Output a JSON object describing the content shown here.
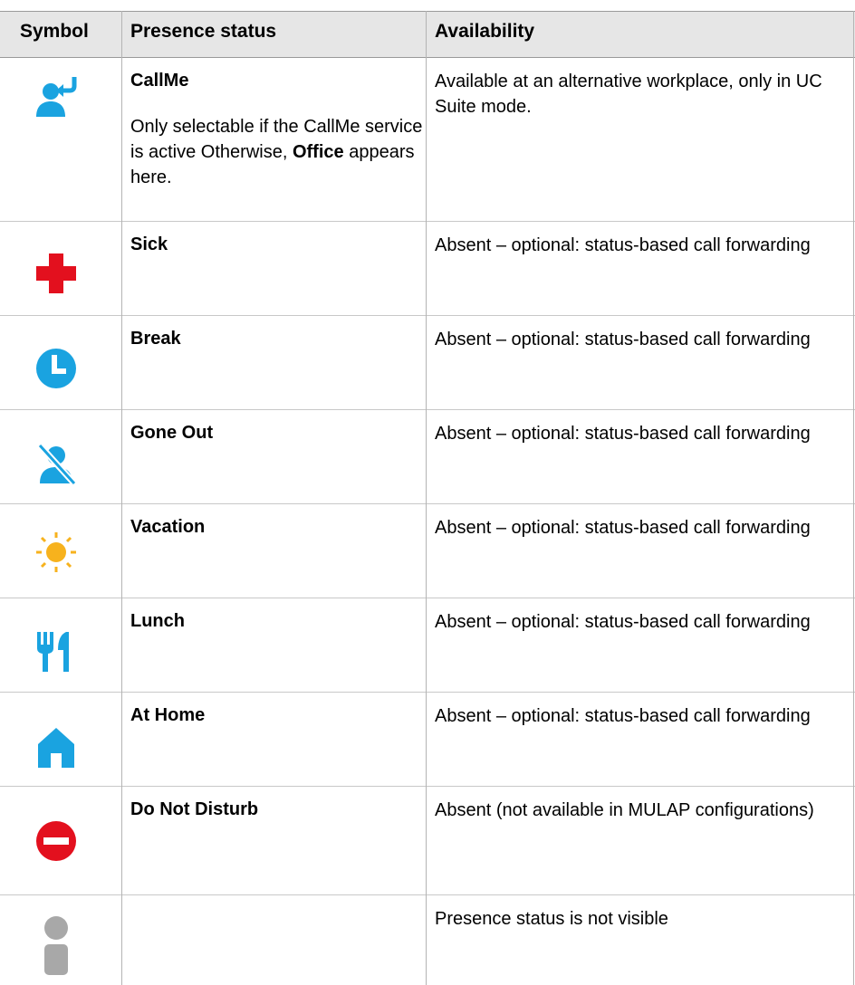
{
  "header": {
    "symbol": "Symbol",
    "presence_status": "Presence status",
    "availability": "Availability"
  },
  "rows": [
    {
      "icon": "callme-icon",
      "status": "CallMe",
      "note_before": "Only selectable if the CallMe service is active Otherwise, ",
      "note_bold": "Office",
      "note_after": " appears here.",
      "availability": "Available at an alternative workplace, only in UC Suite mode."
    },
    {
      "icon": "sick-cross-icon",
      "status": "Sick",
      "availability": "Absent – optional: status-based call forwarding"
    },
    {
      "icon": "break-clock-icon",
      "status": "Break",
      "availability": "Absent – optional: status-based call forwarding"
    },
    {
      "icon": "gone-out-icon",
      "status": "Gone Out",
      "availability": "Absent – optional: status-based call forwarding"
    },
    {
      "icon": "vacation-sun-icon",
      "status": "Vacation",
      "availability": "Absent – optional: status-based call forwarding"
    },
    {
      "icon": "lunch-fork-knife-icon",
      "status": "Lunch",
      "availability": "Absent – optional: status-based call forwarding"
    },
    {
      "icon": "at-home-house-icon",
      "status": "At Home",
      "availability": "Absent – optional: status-based call forwarding"
    },
    {
      "icon": "do-not-disturb-icon",
      "status": "Do Not Disturb",
      "availability": "Absent (not available in MULAP configurations)"
    },
    {
      "icon": "status-not-visible-person-icon",
      "status": "",
      "availability": "Presence status is not visible"
    }
  ],
  "colors": {
    "blue": "#1aa3e0",
    "red": "#e3101e",
    "sun": "#f7b21d",
    "grey": "#a8a8a8",
    "header_bg": "#e6e6e6"
  }
}
